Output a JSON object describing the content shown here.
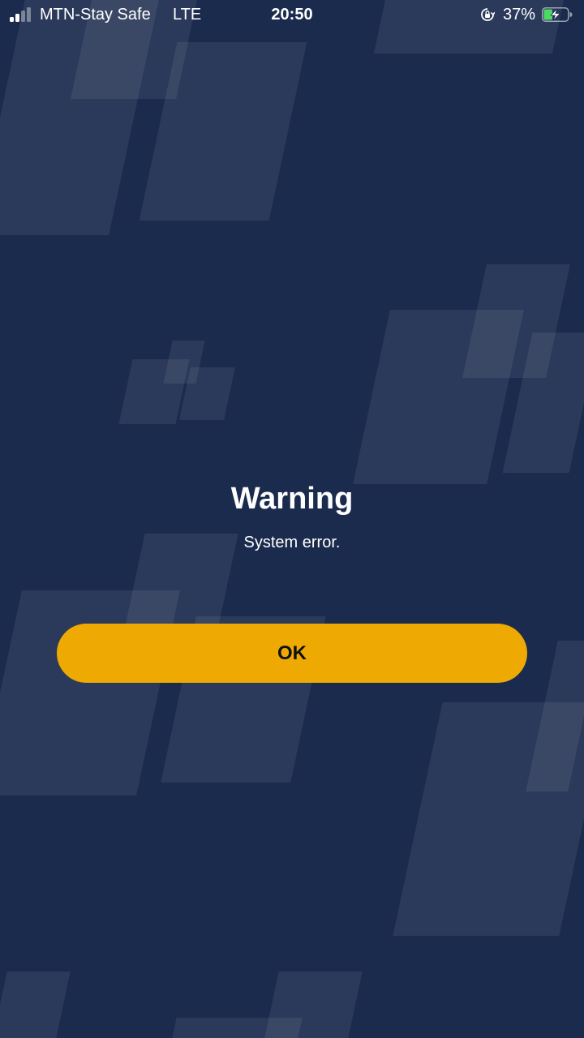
{
  "status_bar": {
    "carrier": "MTN-Stay Safe",
    "network": "LTE",
    "time": "20:50",
    "battery_percent": "37%",
    "battery_level": 0.37,
    "charging": true,
    "orientation_lock_icon": "rotation-lock-icon"
  },
  "dialog": {
    "title": "Warning",
    "message": "System error.",
    "ok_label": "OK"
  },
  "colors": {
    "background": "#1b2b4d",
    "button": "#eea903",
    "battery_fill": "#4cd964"
  }
}
